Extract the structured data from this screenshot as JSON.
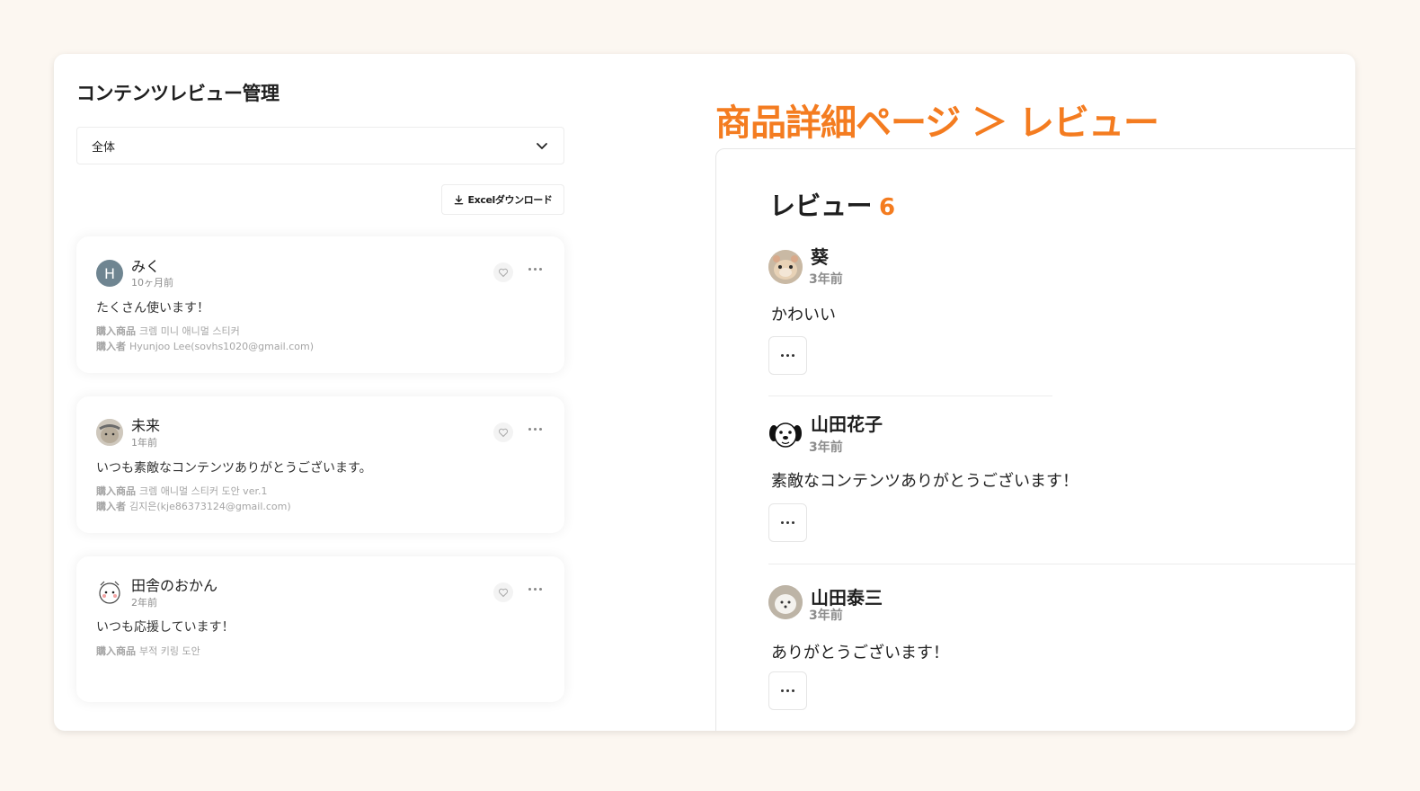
{
  "admin": {
    "title": "コンテンツレビュー管理",
    "filter_value": "全体",
    "excel_label": "Excelダウンロード",
    "reviews": [
      {
        "name": "みく",
        "avatar_letter": "H",
        "time": "10ヶ月前",
        "body": "たくさん使います！",
        "product_label": "購入商品",
        "product": "크렘 미니 애니멀 스티커",
        "buyer_label": "購入者",
        "buyer": "Hyunjoo Lee(sovhs1020@gmail.com)"
      },
      {
        "name": "未来",
        "time": "1年前",
        "body": "いつも素敵なコンテンツありがとうございます。",
        "product_label": "購入商品",
        "product": "크렘 애니멀 스티커 도안 ver.1",
        "buyer_label": "購入者",
        "buyer": "김지은(kje86373124@gmail.com)"
      },
      {
        "name": "田舎のおかん",
        "time": "2年前",
        "body": "いつも応援しています！",
        "product_label": "購入商品",
        "product": "부적 키링 도안"
      }
    ]
  },
  "preview": {
    "heading": "商品詳細ページ ＞ レビュー",
    "panel_title": "レビュー",
    "count": "6",
    "reviews": [
      {
        "name": "葵",
        "time": "3年前",
        "body": "かわいい"
      },
      {
        "name": "山田花子",
        "time": "3年前",
        "body": "素敵なコンテンツありがとうございます！"
      },
      {
        "name": "山田泰三",
        "time": "3年前",
        "body": "ありがとうございます！"
      }
    ]
  },
  "colors": {
    "accent": "#f47c20",
    "background": "#fcf7f1",
    "avatar_letter_bg": "#6f8591"
  }
}
